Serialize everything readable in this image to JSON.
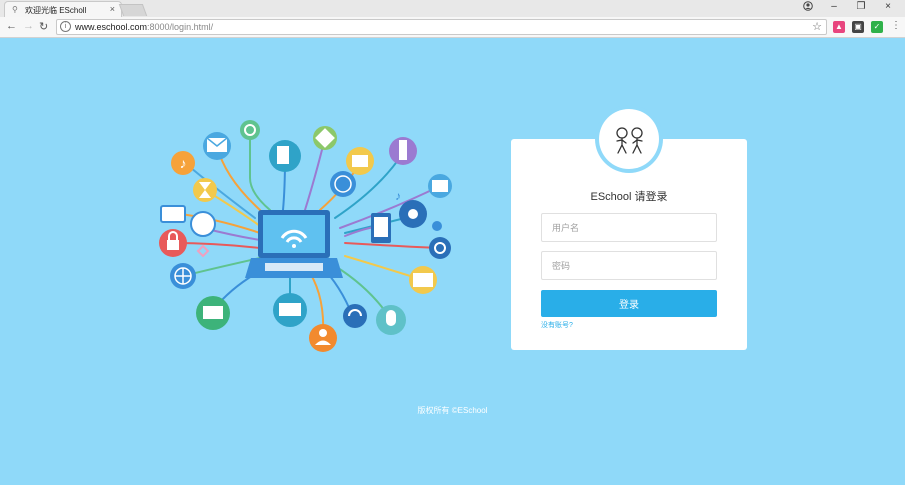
{
  "browser": {
    "tab_title": "欢迎光临 EScholl",
    "tab_close": "×",
    "url_host": "www.eschool.com",
    "url_rest": ":8000/login.html/",
    "window_minimize": "–",
    "window_restore": "❐",
    "window_close": "×"
  },
  "login": {
    "title": "ESchool 请登录",
    "username_placeholder": "用户名",
    "password_placeholder": "密码",
    "submit_label": "登录",
    "register_link": "没有账号?"
  },
  "footer": {
    "copyright": "版权所有 ©ESchool"
  },
  "colors": {
    "page_background": "#8fd9f9",
    "accent": "#29aee8"
  }
}
